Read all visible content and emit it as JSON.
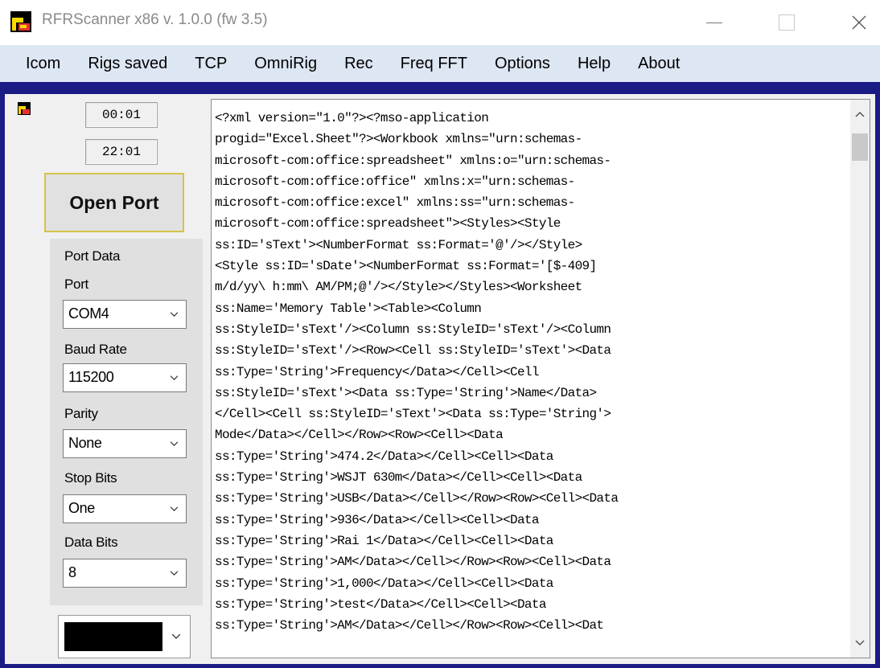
{
  "window": {
    "title": "RFRScanner x86 v. 1.0.0  (fw 3.5)",
    "controls": {
      "minimize": "—",
      "maximize": "☐",
      "close": "✕"
    }
  },
  "menu": [
    "Icom",
    "Rigs saved",
    "TCP",
    "OmniRig",
    "Rec",
    "Freq FFT",
    "Options",
    "Help",
    "About"
  ],
  "timers": {
    "time1": "00:01",
    "time2": "22:01"
  },
  "open_port_label": "Open Port",
  "port_data": {
    "title": "Port Data",
    "port_label": "Port",
    "port_value": "COM4",
    "baud_label": "Baud Rate",
    "baud_value": "115200",
    "parity_label": "Parity",
    "parity_value": "None",
    "stop_label": "Stop Bits",
    "stop_value": "One",
    "databits_label": "Data Bits",
    "databits_value": "8"
  },
  "colors": {
    "frame": "#1b1b86",
    "menubar": "#dde6f3",
    "open_port_border": "#d6c24a",
    "color_swatch": "#000000"
  },
  "text_lines": [
    "<?xml version=\"1.0\"?><?mso-application",
    "progid=\"Excel.Sheet\"?><Workbook xmlns=\"urn:schemas-",
    "microsoft-com:office:spreadsheet\" xmlns:o=\"urn:schemas-",
    "microsoft-com:office:office\" xmlns:x=\"urn:schemas-",
    "microsoft-com:office:excel\" xmlns:ss=\"urn:schemas-",
    "microsoft-com:office:spreadsheet\"><Styles><Style",
    "ss:ID='sText'><NumberFormat ss:Format='@'/></Style>",
    "<Style ss:ID='sDate'><NumberFormat ss:Format='[$-409]",
    "m/d/yy\\ h:mm\\ AM/PM;@'/></Style></Styles><Worksheet",
    "ss:Name='Memory Table'><Table><Column",
    "ss:StyleID='sText'/><Column ss:StyleID='sText'/><Column",
    "ss:StyleID='sText'/><Row><Cell ss:StyleID='sText'><Data",
    "ss:Type='String'>Frequency</Data></Cell><Cell",
    "ss:StyleID='sText'><Data ss:Type='String'>Name</Data>",
    "</Cell><Cell ss:StyleID='sText'><Data ss:Type='String'>",
    "Mode</Data></Cell></Row><Row><Cell><Data",
    "ss:Type='String'>474.2</Data></Cell><Cell><Data",
    "ss:Type='String'>WSJT 630m</Data></Cell><Cell><Data",
    "ss:Type='String'>USB</Data></Cell></Row><Row><Cell><Data",
    "ss:Type='String'>936</Data></Cell><Cell><Data",
    "ss:Type='String'>Rai 1</Data></Cell><Cell><Data",
    "ss:Type='String'>AM</Data></Cell></Row><Row><Cell><Data",
    "ss:Type='String'>1,000</Data></Cell><Cell><Data",
    "ss:Type='String'>test</Data></Cell><Cell><Data",
    "ss:Type='String'>AM</Data></Cell></Row><Row><Cell><Dat"
  ]
}
